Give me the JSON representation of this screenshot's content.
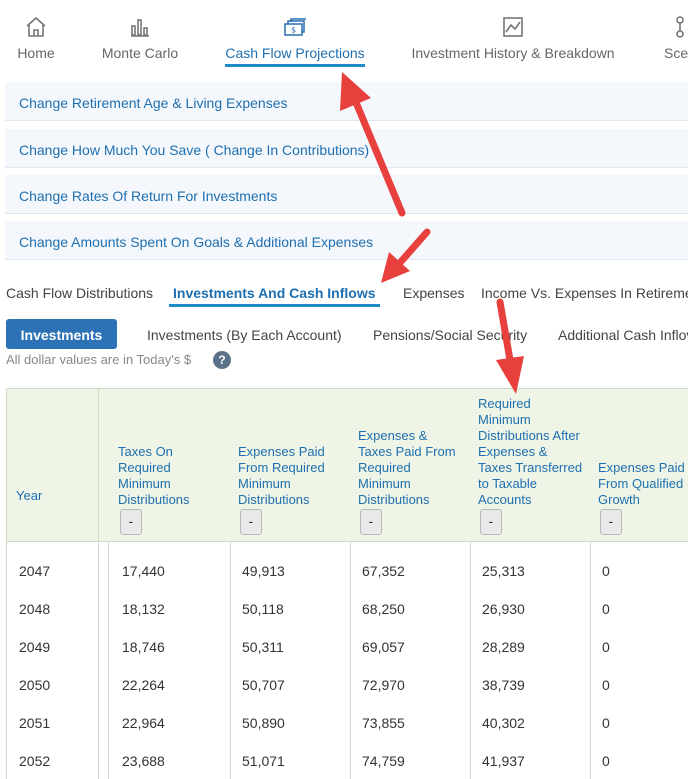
{
  "nav": {
    "items": [
      {
        "label": "Home",
        "icon": "home-icon"
      },
      {
        "label": "Monte Carlo",
        "icon": "bar-chart-icon"
      },
      {
        "label": "Cash Flow Projections",
        "icon": "cash-icon"
      },
      {
        "label": "Investment History & Breakdown",
        "icon": "line-chart-icon"
      },
      {
        "label": "Scen",
        "icon": "scenario-icon"
      }
    ],
    "active": "Cash Flow Projections"
  },
  "accordion": [
    {
      "label": "Change Retirement Age & Living Expenses"
    },
    {
      "label": "Change How Much You Save ( Change In Contributions)"
    },
    {
      "label": "Change Rates Of Return For Investments"
    },
    {
      "label": "Change Amounts Spent On Goals & Additional Expenses"
    }
  ],
  "subtabs": [
    {
      "label": "Cash Flow Distributions"
    },
    {
      "label": "Investments And Cash Inflows"
    },
    {
      "label": "Expenses"
    },
    {
      "label": "Income Vs. Expenses In Retireme"
    }
  ],
  "pills": [
    {
      "label": "Investments"
    },
    {
      "label": "Investments (By Each Account)"
    },
    {
      "label": "Pensions/Social Security"
    },
    {
      "label": "Additional Cash Inflov"
    }
  ],
  "note": "All dollar values are in Today's $",
  "help_label": "?",
  "table": {
    "year_header": "Year",
    "collapse_label": "-",
    "columns": [
      {
        "lines": [
          "Taxes On",
          "Required",
          "Minimum",
          "Distributions"
        ]
      },
      {
        "lines": [
          "Expenses Paid",
          "From Required",
          "Minimum",
          "Distributions"
        ]
      },
      {
        "lines": [
          "Expenses &",
          "Taxes Paid From",
          "Required",
          "Minimum",
          "Distributions"
        ]
      },
      {
        "lines": [
          "Required",
          "Minimum",
          "Distributions After",
          "Expenses &",
          "Taxes Transferred",
          "to Taxable",
          "Accounts"
        ]
      },
      {
        "lines": [
          "Expenses Paid",
          "From Qualified",
          "Growth"
        ]
      }
    ],
    "rows": [
      {
        "year": "2047",
        "values": [
          "17,440",
          "49,913",
          "67,352",
          "25,313",
          "0"
        ]
      },
      {
        "year": "2048",
        "values": [
          "18,132",
          "50,118",
          "68,250",
          "26,930",
          "0"
        ]
      },
      {
        "year": "2049",
        "values": [
          "18,746",
          "50,311",
          "69,057",
          "28,289",
          "0"
        ]
      },
      {
        "year": "2050",
        "values": [
          "22,264",
          "50,707",
          "72,970",
          "38,739",
          "0"
        ]
      },
      {
        "year": "2051",
        "values": [
          "22,964",
          "50,890",
          "73,855",
          "40,302",
          "0"
        ]
      },
      {
        "year": "2052",
        "values": [
          "23,688",
          "51,071",
          "74,759",
          "41,937",
          "0"
        ]
      }
    ]
  },
  "colors": {
    "accent": "#1f6fb0",
    "active_pill": "#2e72b6",
    "header_bg": "#eef5e6",
    "arrow": "#e8403d"
  }
}
